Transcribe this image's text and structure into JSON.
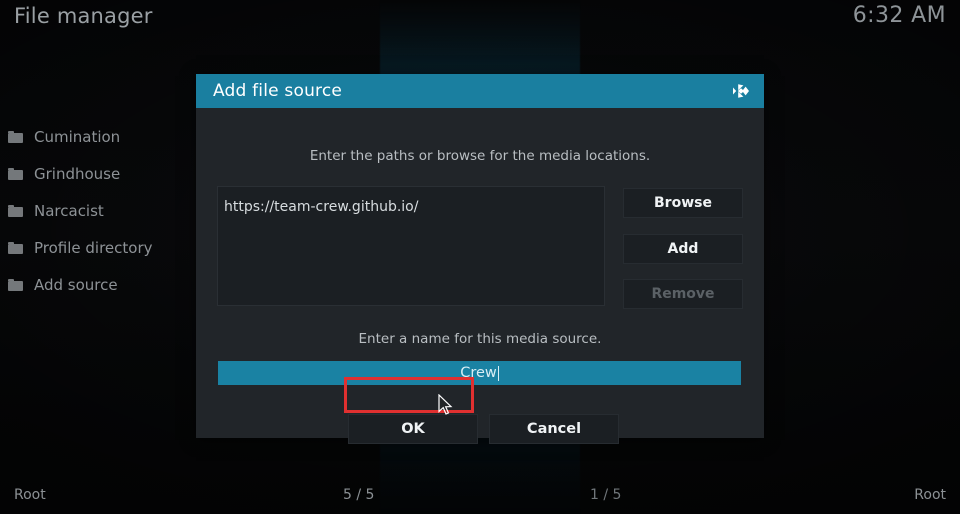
{
  "window": {
    "title": "File manager",
    "clock": "6:32 AM"
  },
  "filelist": {
    "items": [
      {
        "icon": "folder-icon",
        "label": "Cumination"
      },
      {
        "icon": "folder-icon",
        "label": "Grindhouse"
      },
      {
        "icon": "folder-icon",
        "label": "Narcacist"
      },
      {
        "icon": "folder-icon",
        "label": "Profile directory"
      },
      {
        "icon": "folder-icon",
        "label": "Add source"
      }
    ]
  },
  "statusbar": {
    "left_path": "Root",
    "left_count": "5 / 5",
    "right_count": "1 / 5",
    "right_path": "Root"
  },
  "dialog": {
    "title": "Add file source",
    "logo_icon": "kodi-logo-icon",
    "paths_hint": "Enter the paths or browse for the media locations.",
    "path_entries": [
      "https://team-crew.github.io/"
    ],
    "buttons": {
      "browse": "Browse",
      "add": "Add",
      "remove": "Remove"
    },
    "name_hint": "Enter a name for this media source.",
    "name_value": "Crew",
    "actions": {
      "ok": "OK",
      "cancel": "Cancel"
    }
  },
  "annotation": {
    "highlight_color": "#e03030",
    "target": "ok-button",
    "cursor_icon": "mouse-pointer-icon"
  },
  "colors": {
    "accent_teal": "#1a7fa0",
    "field_teal": "#1a82a3",
    "dialog_bg": "#212529",
    "panel_bg": "#1b1f23",
    "text_primary": "#f0f3f5",
    "text_muted": "#8d9296",
    "text_disabled": "#5b6166"
  }
}
